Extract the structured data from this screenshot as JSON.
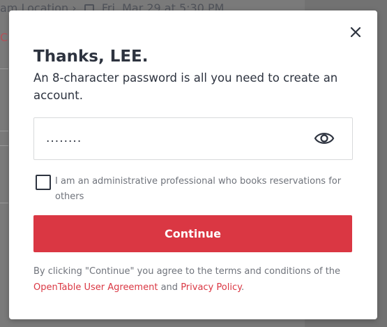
{
  "background": {
    "reservation_text": "am Location",
    "reservation_date": "Fri, Mar 29 at 5:30 PM",
    "background_link_initial": "C"
  },
  "modal": {
    "title": "Thanks, LEE.",
    "subtitle": "An 8-character password is all you need to create an account.",
    "password_value": "........",
    "password_visibility_icon": "eye-icon",
    "checkbox_checked": false,
    "checkbox_label": "I am an administrative professional who books reservations for others",
    "continue_label": "Continue",
    "terms_prefix": "By clicking \"Continue\" you agree to the terms and conditions of the",
    "user_agreement_link": "OpenTable User Agreement",
    "terms_and": "and",
    "privacy_link": "Privacy Policy",
    "terms_suffix": "."
  },
  "colors": {
    "accent": "#da3743",
    "text_primary": "#2d333f",
    "text_secondary": "#6f737b",
    "border": "#d8d9db"
  }
}
